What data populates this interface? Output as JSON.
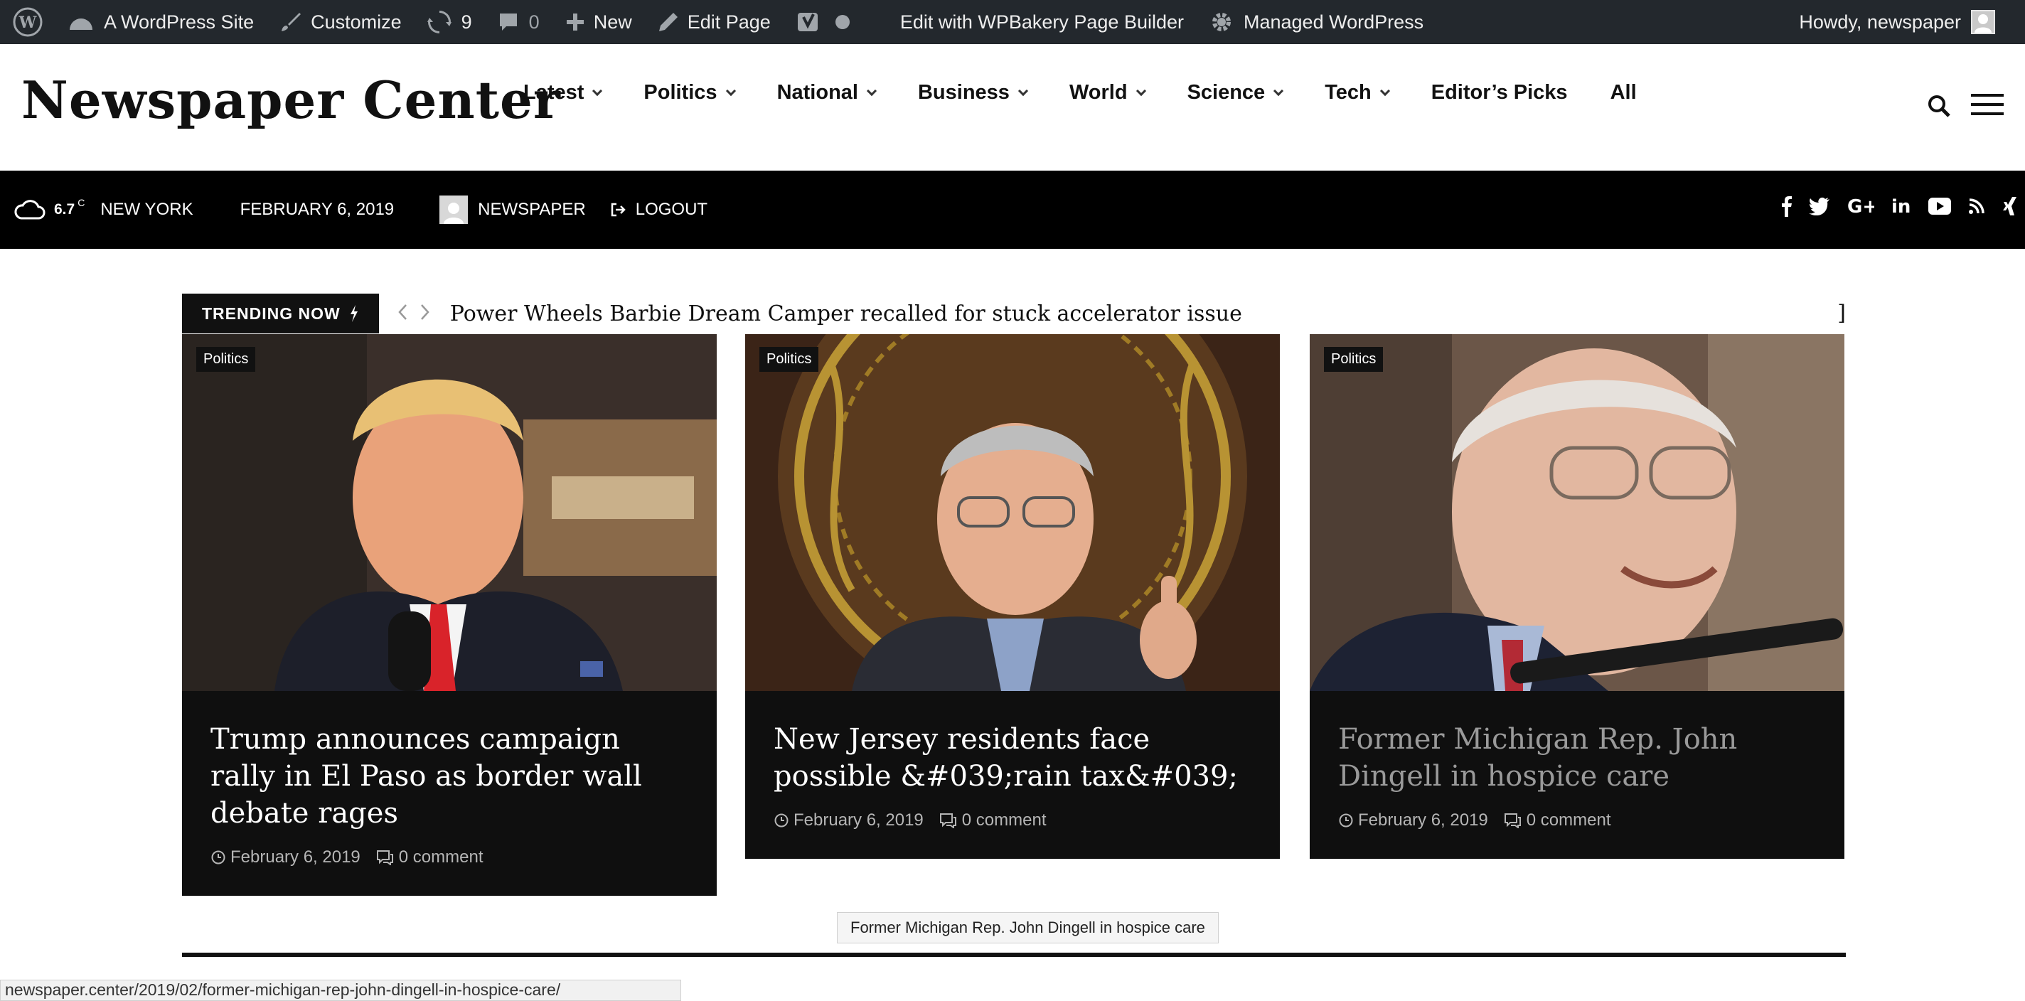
{
  "adminbar": {
    "site_name": "A WordPress Site",
    "customize": "Customize",
    "updates_count": "9",
    "comments_count": "0",
    "new_label": "New",
    "edit_page": "Edit Page",
    "wpbakery": "Edit with WPBakery Page Builder",
    "managed_wp": "Managed WordPress",
    "howdy": "Howdy, newspaper"
  },
  "header": {
    "logo": "Newspaper Center",
    "nav": [
      {
        "label": "Latest",
        "has_dropdown": true
      },
      {
        "label": "Politics",
        "has_dropdown": true
      },
      {
        "label": "National",
        "has_dropdown": true
      },
      {
        "label": "Business",
        "has_dropdown": true
      },
      {
        "label": "World",
        "has_dropdown": true
      },
      {
        "label": "Science",
        "has_dropdown": true
      },
      {
        "label": "Tech",
        "has_dropdown": true
      },
      {
        "label": "Editor’s Picks",
        "has_dropdown": false
      },
      {
        "label": "All",
        "has_dropdown": false
      }
    ]
  },
  "topbar": {
    "temp": "6.7",
    "unit": "C",
    "city": "NEW YORK",
    "date": "FEBRUARY 6, 2019",
    "user": "NEWSPAPER",
    "logout": "LOGOUT",
    "social_icons": [
      "facebook-icon",
      "twitter-icon",
      "google-plus-icon",
      "linkedin-icon",
      "youtube-icon",
      "rss-icon",
      "xing-icon"
    ]
  },
  "trending": {
    "label": "TRENDING NOW",
    "headline": "Power Wheels Barbie Dream Camper recalled for stuck accelerator issue",
    "trailing": "]"
  },
  "cards": [
    {
      "category": "Politics",
      "title": "Trump announces campaign rally in El Paso as border wall debate rages",
      "date": "February 6, 2019",
      "comments": "0 comment"
    },
    {
      "category": "Politics",
      "title": "New Jersey residents face possible &#039;rain tax&#039;",
      "date": "February 6, 2019",
      "comments": "0 comment"
    },
    {
      "category": "Politics",
      "title": "Former Michigan Rep. John Dingell in hospice care",
      "date": "February 6, 2019",
      "comments": "0 comment"
    }
  ],
  "tooltip": "Former Michigan Rep. John Dingell in hospice care",
  "status_url": "newspaper.center/2019/02/former-michigan-rep-john-dingell-in-hospice-care/",
  "colors": {
    "adminbar_bg": "#23282d",
    "topbar_bg": "#000000",
    "card_bg": "#0f0f0f",
    "hover_title": "#9a9a9a"
  }
}
